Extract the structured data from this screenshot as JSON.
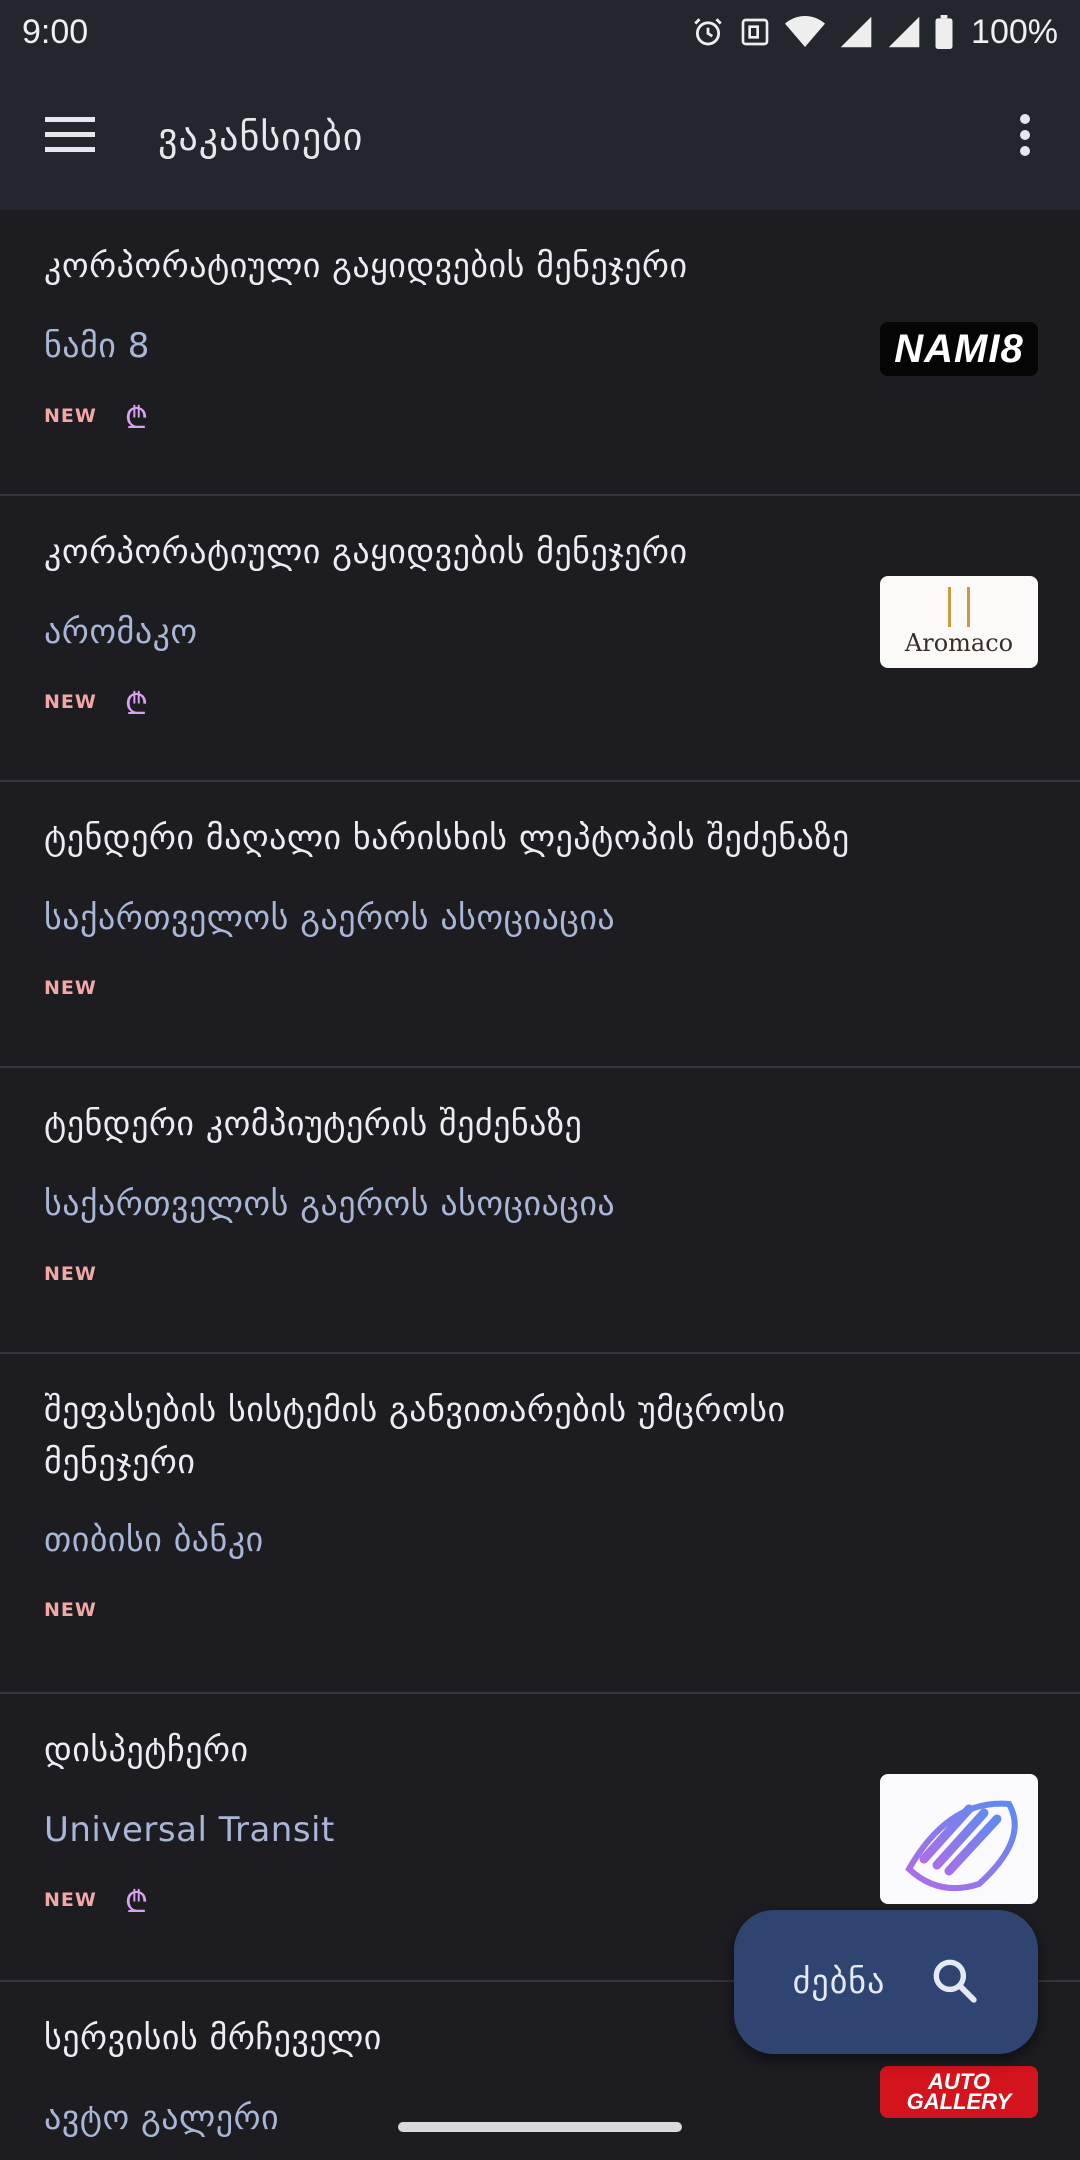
{
  "status_bar": {
    "time": "9:00",
    "battery": "100%"
  },
  "toolbar": {
    "title": "ვაკანსიები"
  },
  "jobs": [
    {
      "title": "კორპორატიული გაყიდვების მენეჯერი",
      "company": "ნამი 8",
      "new_badge": "NEW",
      "salary_badge": "₾",
      "logo_text": "NAMI8"
    },
    {
      "title": "კორპორატიული გაყიდვების მენეჯერი",
      "company": "არომაკო",
      "new_badge": "NEW",
      "salary_badge": "₾",
      "logo_text": "Aromaco"
    },
    {
      "title": "ტენდერი მაღალი ხარისხის ლეპტოპის შეძენაზე",
      "company": "საქართველოს გაეროს ასოციაცია",
      "new_badge": "NEW"
    },
    {
      "title": "ტენდერი კომპიუტერის შეძენაზე",
      "company": "საქართველოს გაეროს ასოციაცია",
      "new_badge": "NEW"
    },
    {
      "title": "შეფასების სისტემის განვითარების უმცროსი მენეჯერი",
      "company": "თიბისი ბანკი",
      "new_badge": "NEW"
    },
    {
      "title": "დისპეტჩერი",
      "company": "Universal Transit",
      "new_badge": "NEW",
      "salary_badge": "₾"
    },
    {
      "title": "სერვისის მრჩეველი",
      "company": "ავტო გალერი",
      "logo_text": "AUTO GALLERY"
    }
  ],
  "fab": {
    "label": "ძებნა",
    "icon": "search-icon"
  },
  "colors": {
    "background": "#1c1c21",
    "toolbar": "#24262e",
    "company_text": "#a9b6d6",
    "new_badge": "#f3a8a8",
    "salary_badge": "#d7a3f0",
    "fab": "#2f4470"
  }
}
